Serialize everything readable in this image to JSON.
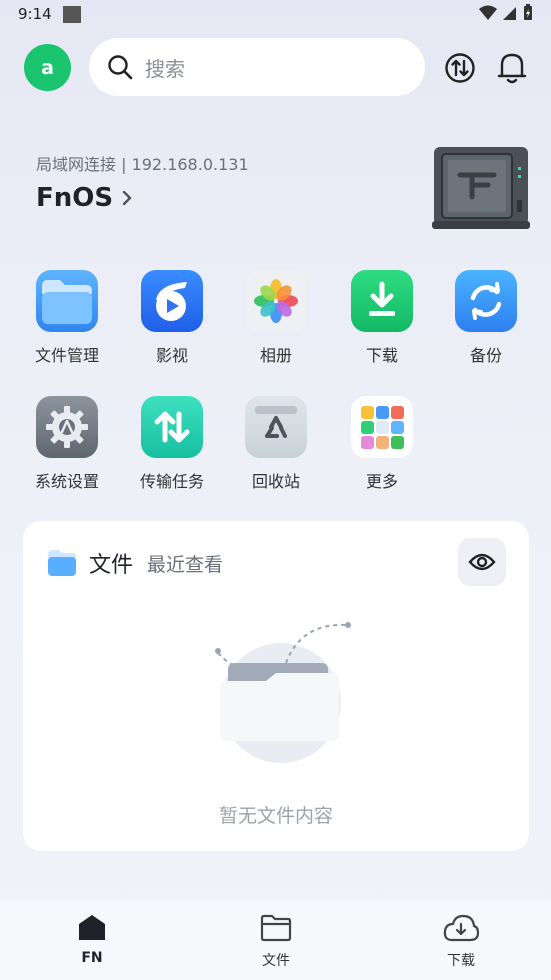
{
  "status_bar": {
    "time": "9:14"
  },
  "topbar": {
    "avatar_letter": "a",
    "search_placeholder": "搜索",
    "avatar_color": "#1bc46f"
  },
  "server": {
    "connection": "局域网连接 | 192.168.0.131",
    "name": "FnOS"
  },
  "apps": [
    {
      "label": "文件管理",
      "icon": "folder-icon"
    },
    {
      "label": "影视",
      "icon": "film-icon"
    },
    {
      "label": "相册",
      "icon": "photos-icon"
    },
    {
      "label": "下载",
      "icon": "download-icon"
    },
    {
      "label": "备份",
      "icon": "backup-icon"
    },
    {
      "label": "系统设置",
      "icon": "settings-icon"
    },
    {
      "label": "传输任务",
      "icon": "transfer-icon"
    },
    {
      "label": "回收站",
      "icon": "recycle-bin-icon"
    },
    {
      "label": "更多",
      "icon": "more-apps-icon"
    }
  ],
  "files_card": {
    "title": "文件",
    "subtitle": "最近查看",
    "empty_text": "暂无文件内容"
  },
  "bottom_nav": [
    {
      "label": "FN",
      "icon": "home-icon",
      "active": true
    },
    {
      "label": "文件",
      "icon": "folder-outline-icon",
      "active": false
    },
    {
      "label": "下载",
      "icon": "cloud-download-icon",
      "active": false
    }
  ]
}
